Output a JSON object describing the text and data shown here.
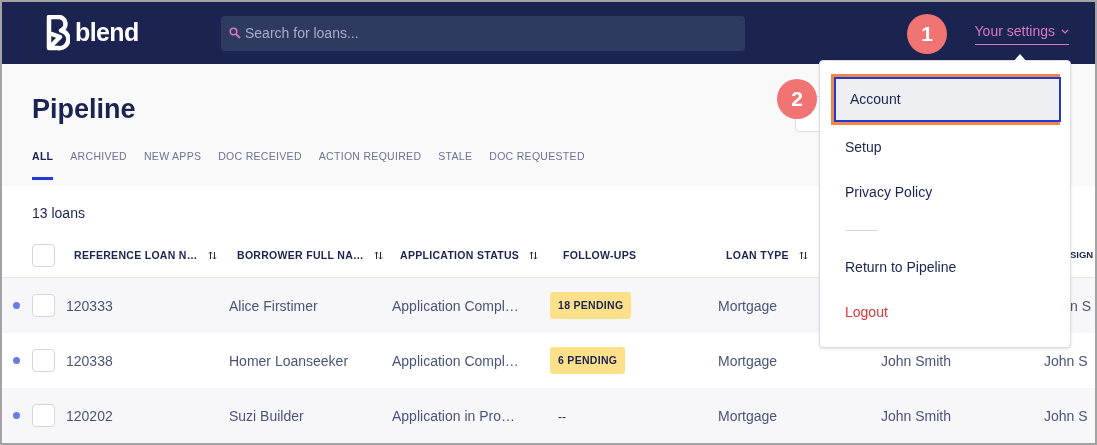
{
  "header": {
    "logo": "blend",
    "search": {
      "placeholder": "Search for loans..."
    },
    "settings_menu": {
      "label": "Your settings",
      "expanded": true
    }
  },
  "page": {
    "title": "Pipeline",
    "tabs": [
      {
        "label": "ALL",
        "selected": true
      },
      {
        "label": "ARCHIVED",
        "selected": false
      },
      {
        "label": "NEW APPS",
        "selected": false
      },
      {
        "label": "DOC RECEIVED",
        "selected": false
      },
      {
        "label": "ACTION REQUIRED",
        "selected": false
      },
      {
        "label": "STALE",
        "selected": false
      },
      {
        "label": "DOC REQUESTED",
        "selected": false
      }
    ],
    "count": "13 loans"
  },
  "table": {
    "select_all_checked": false,
    "columns": [
      {
        "label": "REFERENCE LOAN N…",
        "sortable": true
      },
      {
        "label": "BORROWER FULL NA…",
        "sortable": true
      },
      {
        "label": "APPLICATION STATUS",
        "sortable": true
      },
      {
        "label": "FOLLOW-UPS"
      },
      {
        "label": "LOAN TYPE",
        "sortable": true
      },
      {
        "label": "SIGN"
      }
    ],
    "rows": [
      {
        "unread": true,
        "checked": false,
        "reference": "120333",
        "borrower": "Alice Firstimer",
        "status": "Application Compl…",
        "followups": {
          "kind": "badge",
          "text": "18 PENDING"
        },
        "loan_type": "Mortgage",
        "column_8": "n S"
      },
      {
        "unread": true,
        "checked": false,
        "reference": "120338",
        "borrower": "Homer Loanseeker",
        "status": "Application Compl…",
        "followups": {
          "kind": "badge",
          "text": "6 PENDING"
        },
        "loan_type": "Mortgage",
        "column_7": "John Smith",
        "column_8": "John S"
      },
      {
        "unread": true,
        "checked": false,
        "reference": "120202",
        "borrower": "Suzi Builder",
        "status": "Application in Pro…",
        "followups": {
          "kind": "plain",
          "text": "--"
        },
        "loan_type": "Mortgage",
        "column_7": "John Smith",
        "column_8": "John S"
      }
    ]
  },
  "dropdown": {
    "items": [
      {
        "kind": "link",
        "label": "Account",
        "selected": true
      },
      {
        "kind": "link",
        "label": "Setup",
        "selected": false
      },
      {
        "kind": "link",
        "label": "Privacy Policy",
        "selected": false
      },
      {
        "kind": "divider"
      },
      {
        "kind": "link",
        "label": "Return to Pipeline",
        "selected": false
      },
      {
        "kind": "danger",
        "label": "Logout",
        "selected": false
      }
    ]
  },
  "callouts": [
    {
      "number": "1"
    },
    {
      "number": "2"
    }
  ]
}
